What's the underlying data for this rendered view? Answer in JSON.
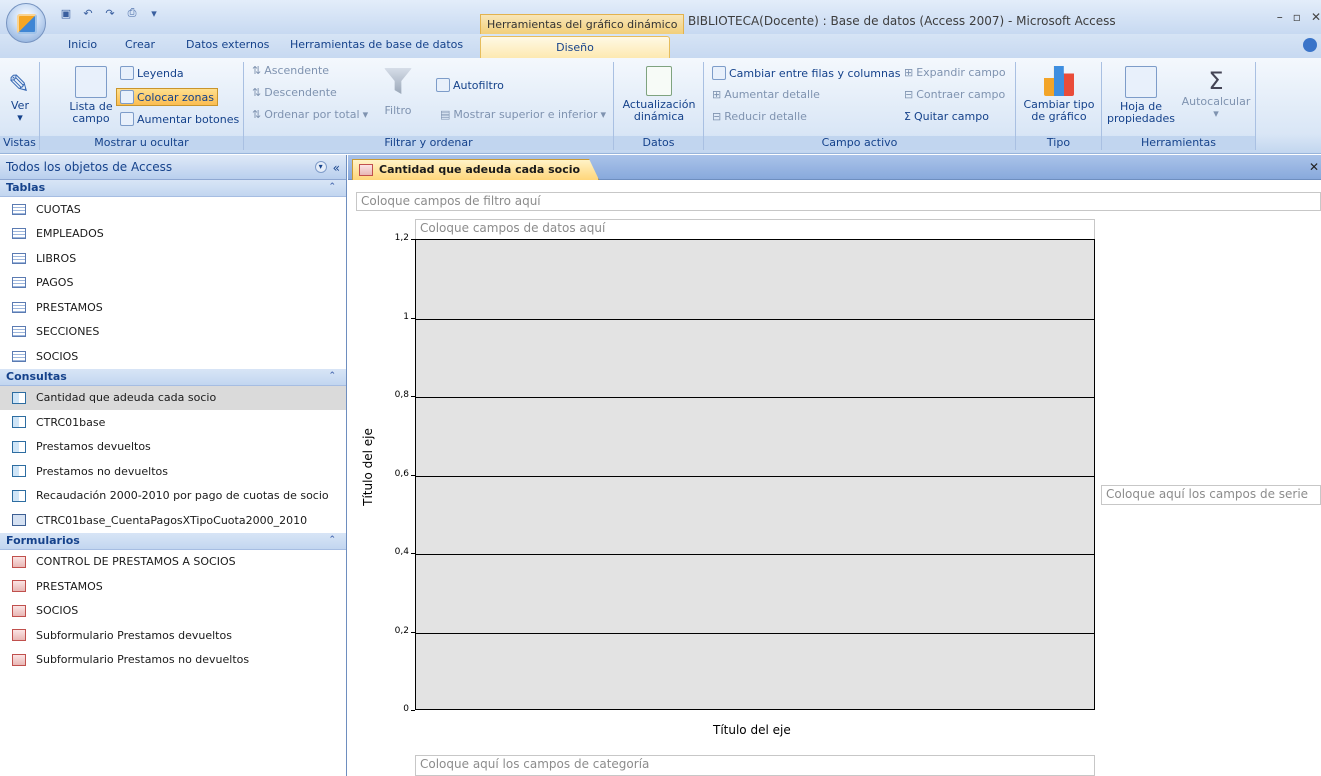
{
  "window": {
    "contextual_tab_title": "Herramientas del gráfico dinámico",
    "app_title": "BIBLIOTECA(Docente) : Base de datos (Access 2007) - Microsoft Access"
  },
  "tabs": [
    "Inicio",
    "Crear",
    "Datos externos",
    "Herramientas de base de datos",
    "Diseño"
  ],
  "ribbon": {
    "vistas": {
      "label": "Vistas",
      "ver": "Ver"
    },
    "mostrar": {
      "label": "Mostrar u ocultar",
      "lista_campo": "Lista de campo",
      "leyenda": "Leyenda",
      "colocar_zonas": "Colocar zonas",
      "aumentar_botones": "Aumentar botones"
    },
    "filtrar": {
      "label": "Filtrar y ordenar",
      "ascendente": "Ascendente",
      "descendente": "Descendente",
      "ordenar_total": "Ordenar por total",
      "filtro": "Filtro",
      "autofiltro": "Autofiltro",
      "mostrar_sup_inf": "Mostrar superior e inferior"
    },
    "datos": {
      "label": "Datos",
      "actualizacion": "Actualización",
      "dinamica": "dinámica"
    },
    "campo_activo": {
      "label": "Campo activo",
      "cambiar_filas": "Cambiar entre filas y columnas",
      "expandir": "Expandir campo",
      "aumentar_detalle": "Aumentar detalle",
      "contraer": "Contraer campo",
      "reducir_detalle": "Reducir detalle",
      "quitar_campo": "Quitar campo"
    },
    "tipo": {
      "label": "Tipo",
      "cambiar_tipo": "Cambiar tipo",
      "de_grafico": "de gráfico"
    },
    "herramientas": {
      "label": "Herramientas",
      "hoja": "Hoja de",
      "propiedades": "propiedades",
      "autocalcular": "Autocalcular"
    }
  },
  "nav": {
    "header": "Todos los objetos de Access",
    "sections": [
      {
        "title": "Tablas",
        "items": [
          "CUOTAS",
          "EMPLEADOS",
          "LIBROS",
          "PAGOS",
          "PRESTAMOS",
          "SECCIONES",
          "SOCIOS"
        ]
      },
      {
        "title": "Consultas",
        "items": [
          "Cantidad que adeuda cada socio",
          "CTRC01base",
          "Prestamos devueltos",
          "Prestamos no devueltos",
          "Recaudación 2000-2010 por pago de cuotas de socio",
          "CTRC01base_CuentaPagosXTipoCuota2000_2010"
        ]
      },
      {
        "title": "Formularios",
        "items": [
          "CONTROL DE PRESTAMOS A SOCIOS",
          "PRESTAMOS",
          "SOCIOS",
          "Subformulario Prestamos devueltos",
          "Subformulario Prestamos no devueltos"
        ]
      }
    ]
  },
  "document": {
    "tab_title": "Cantidad que adeuda cada socio",
    "filter_zone": "Coloque campos de filtro aquí",
    "data_zone": "Coloque campos de datos aquí",
    "series_zone": "Coloque aquí los campos de serie",
    "category_zone": "Coloque aquí los campos de categoría"
  },
  "chart_data": {
    "type": "bar",
    "categories": [],
    "series": [],
    "xlabel": "Título del eje",
    "ylabel": "Título del eje",
    "ylim": [
      0,
      1.2
    ],
    "yticks": [
      "0",
      "0,2",
      "0,4",
      "0,6",
      "0,8",
      "1",
      "1,2"
    ],
    "grid": true
  }
}
